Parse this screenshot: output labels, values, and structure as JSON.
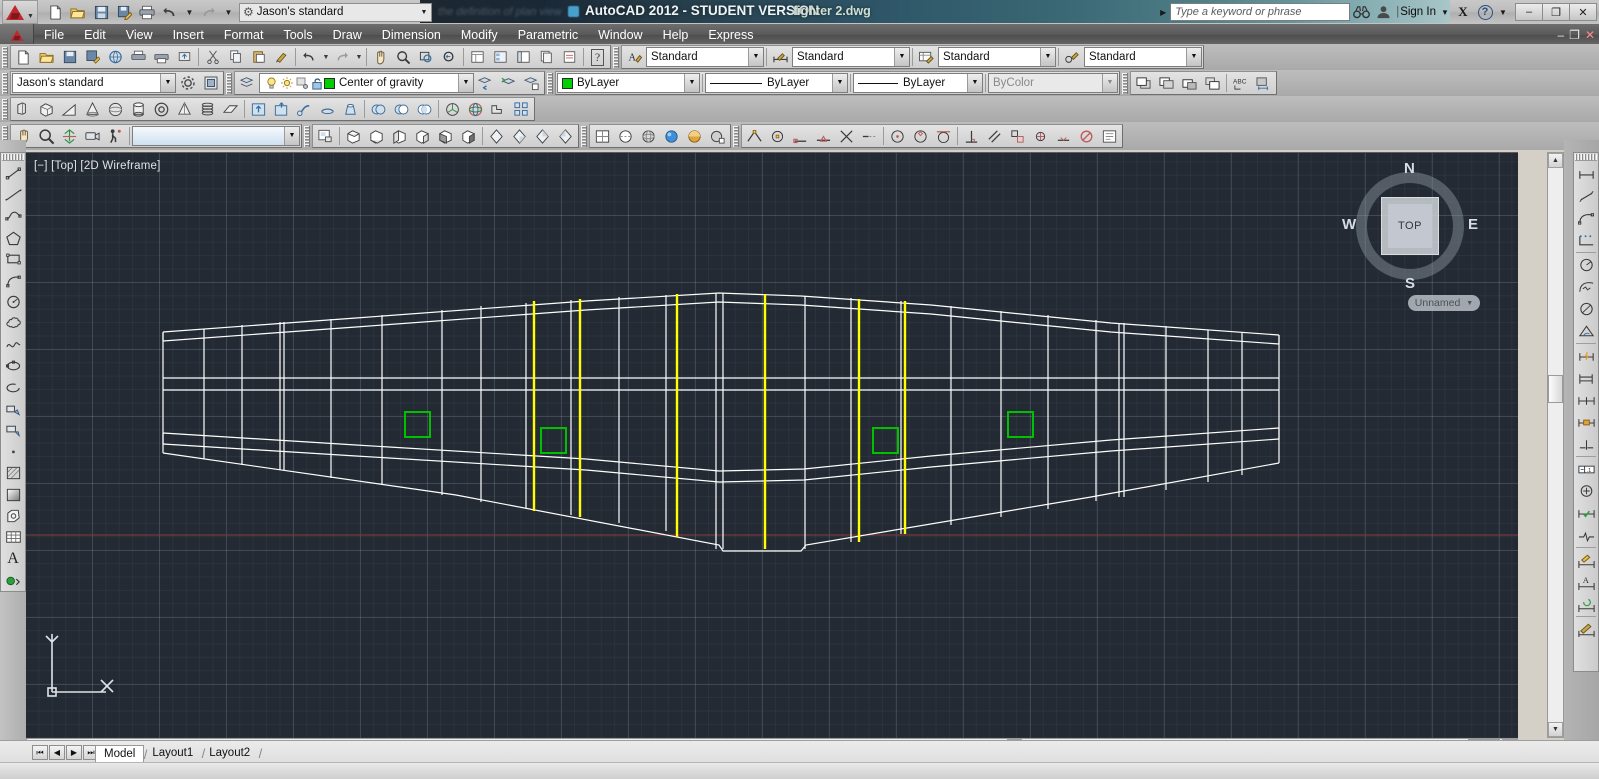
{
  "titlebar": {
    "app_title": "AutoCAD 2012 - STUDENT VERSION",
    "file_name": "fighter 2.dwg",
    "ghost_text": "the definition of plan view",
    "quick_access": {
      "workspace_value": "Jason's standard",
      "icons": [
        "new-icon",
        "open-icon",
        "save-icon",
        "saveas-icon",
        "plot-icon",
        "undo-icon",
        "redo-icon"
      ],
      "gear_label": "gear-icon",
      "more_label": "more-icon"
    },
    "search_placeholder": "Type a keyword or phrase",
    "signin_label": "Sign In",
    "exchange_label": "X",
    "help_label": "?",
    "window_buttons": {
      "minimize": "–",
      "restore": "❐",
      "close": "✕"
    }
  },
  "menubar": {
    "items": [
      "File",
      "Edit",
      "View",
      "Insert",
      "Format",
      "Tools",
      "Draw",
      "Dimension",
      "Modify",
      "Parametric",
      "Window",
      "Help",
      "Express"
    ],
    "right_buttons": {
      "minimize": "–",
      "restore": "❐",
      "close": "✕"
    }
  },
  "toolbars": {
    "row1": {
      "style_standard_1": "Standard",
      "style_standard_2": "Standard",
      "style_standard_3": "Standard",
      "style_standard_4": "Standard",
      "help_marker": "?"
    },
    "row2": {
      "workspace_value": "Jason's standard",
      "layer_value": "Center of gravity",
      "layer_color": "#00d000",
      "color_value": "ByLayer",
      "linetype_value": "ByLayer",
      "lineweight_value": "ByLayer",
      "plotstyle_value": "ByColor"
    }
  },
  "canvas": {
    "viewport_label": "[−] [Top] [2D Wireframe]",
    "background_color": "#232a33",
    "viewcube": {
      "face_label": "TOP",
      "north": "N",
      "south": "S",
      "east": "E",
      "west": "W",
      "ucs_selector": "Unnamed"
    },
    "ucs_icon": {
      "x_label": "X",
      "y_label": "Y"
    },
    "drawing_colors": {
      "geometry": "#ffffff",
      "highlight": "#ffff00",
      "marker": "#00c000",
      "centerline": "#8b3a3a"
    }
  },
  "tabbar": {
    "nav": [
      "⏮",
      "◀",
      "▶",
      "⏭"
    ],
    "tabs": [
      {
        "label": "Model",
        "active": true
      },
      {
        "label": "Layout1",
        "active": false
      },
      {
        "label": "Layout2",
        "active": false
      }
    ]
  },
  "left_toolbar": {
    "items": [
      "line-icon",
      "construction-line-icon",
      "polyline-icon",
      "polygon-icon",
      "rectangle-icon",
      "arc-icon",
      "circle-icon",
      "revision-cloud-icon",
      "spline-icon",
      "ellipse-icon",
      "ellipse-arc-icon",
      "insert-block-icon",
      "make-block-icon",
      "point-icon",
      "hatch-icon",
      "gradient-icon",
      "region-icon",
      "table-icon",
      "multiline-text-icon",
      "add-selected-icon"
    ]
  },
  "right_toolbar": {
    "items": [
      "linear-dimension-icon",
      "aligned-dimension-icon",
      "arc-length-dimension-icon",
      "ordinate-dimension-icon",
      "radius-dimension-icon",
      "jogged-dimension-icon",
      "diameter-dimension-icon",
      "angular-dimension-icon",
      "quick-dimension-icon",
      "baseline-dimension-icon",
      "continue-dimension-icon",
      "dimension-space-icon",
      "dimension-break-icon",
      "tolerance-icon",
      "center-mark-icon",
      "inspection-icon",
      "jogged-linear-icon",
      "edit-dimension-icon",
      "edit-dimension-text-icon",
      "dimension-update-icon",
      "dimension-style-icon"
    ]
  }
}
